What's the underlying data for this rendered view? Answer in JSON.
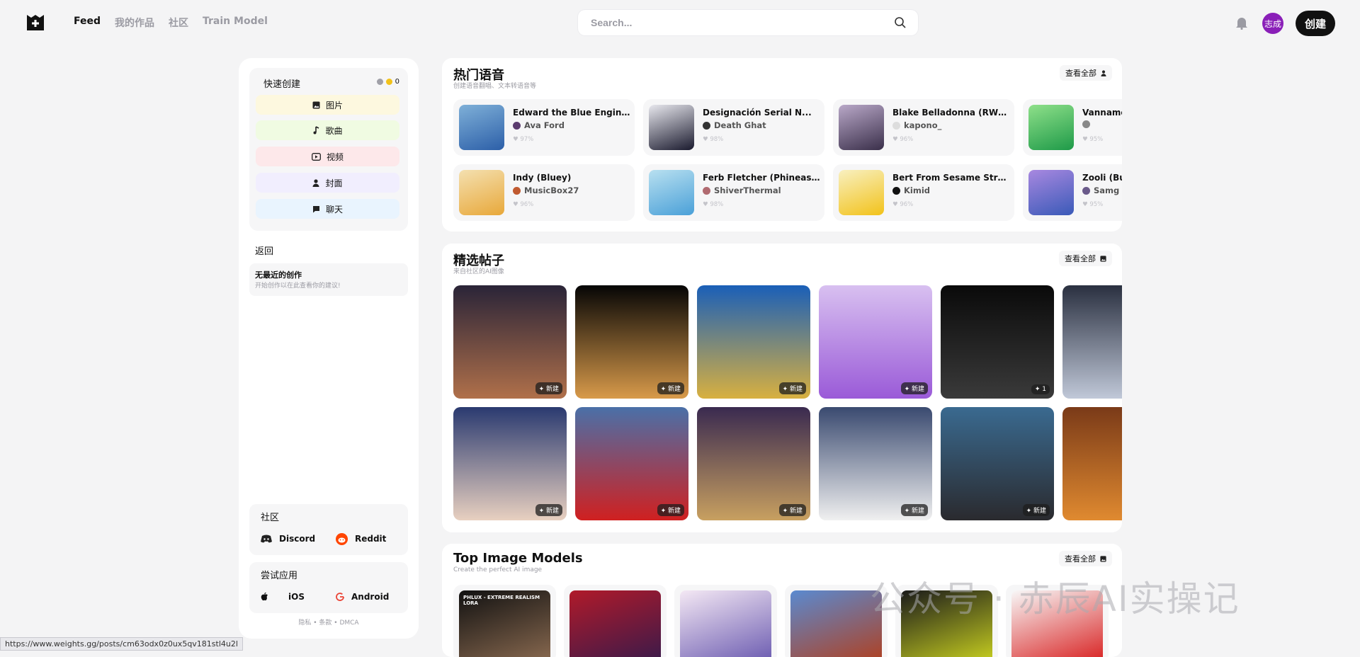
{
  "nav": {
    "feed": "Feed",
    "my_works": "我的作品",
    "community": "社区",
    "train": "Train Model"
  },
  "search": {
    "placeholder": "Search..."
  },
  "user": {
    "avatar_text": "志成",
    "create_label": "创建"
  },
  "sidebar": {
    "quick_create": "快速创建",
    "coins": "0",
    "buttons": [
      {
        "label": "图片",
        "color": "#fdf8df",
        "icon": "image-icon"
      },
      {
        "label": "歌曲",
        "color": "#f0fbe2",
        "icon": "music-note-icon"
      },
      {
        "label": "视频",
        "color": "#fde8ea",
        "icon": "video-icon"
      },
      {
        "label": "封面",
        "color": "#f1eefe",
        "icon": "person-icon"
      },
      {
        "label": "聊天",
        "color": "#e9f4fe",
        "icon": "chat-icon"
      }
    ],
    "back": "返回",
    "recent_title": "无最近的创作",
    "recent_sub": "开始创作以在此查看你的建议!",
    "community": "社区",
    "discord": "Discord",
    "reddit": "Reddit",
    "try_app": "尝试应用",
    "ios": "iOS",
    "android": "Android",
    "footer": "隐私 • 条款 • DMCA"
  },
  "voices": {
    "title": "热门语音",
    "subtitle": "创建语音翻唱、文本转语音等",
    "view_all": "查看全部",
    "items": [
      {
        "name": "Edward the Blue Engine...",
        "author": "Ava Ford",
        "pct": "97%",
        "c1": "#2c5fa8",
        "c2": "#7fb0d8",
        "ac": "#5b3b6e"
      },
      {
        "name": "Designación Serial N...",
        "author": "Death Ghat",
        "pct": "98%",
        "c1": "#1a1a2e",
        "c2": "#e8e8ee",
        "ac": "#333"
      },
      {
        "name": "Blake Belladonna (RWBY)",
        "author": "kapono_",
        "pct": "96%",
        "c1": "#3a2f4a",
        "c2": "#b9a8c8",
        "ac": "#ddd"
      },
      {
        "name": "Vannamelon",
        "author": "",
        "pct": "95%",
        "c1": "#1e9a48",
        "c2": "#8fe08a",
        "ac": "#888"
      },
      {
        "name": "Indy (Bluey)",
        "author": "MusicBox27",
        "pct": "96%",
        "c1": "#e8a83a",
        "c2": "#f4e0b0",
        "ac": "#c05a30"
      },
      {
        "name": "Ferb Fletcher (Phineas...",
        "author": "ShiverThermal",
        "pct": "98%",
        "c1": "#4aa0d8",
        "c2": "#b8e0f0",
        "ac": "#b06a70"
      },
      {
        "name": "Bert From Sesame Street",
        "author": "Kimid",
        "pct": "96%",
        "c1": "#f2c21a",
        "c2": "#f8f0c0",
        "ac": "#111"
      },
      {
        "name": "Zooli (Bub",
        "author": "Samg",
        "pct": "95%",
        "c1": "#3a5ab8",
        "c2": "#a888e0",
        "ac": "#6a5a8a"
      }
    ]
  },
  "posts": {
    "title": "精选帖子",
    "subtitle": "来自社区的AI图像",
    "view_all": "查看全部",
    "items": [
      {
        "badge": "新建",
        "c1": "#2a2438",
        "c2": "#b0704a"
      },
      {
        "badge": "新建",
        "c1": "#050505",
        "c2": "#d89a4a"
      },
      {
        "badge": "新建",
        "c1": "#1a5fb8",
        "c2": "#d8b040"
      },
      {
        "badge": "新建",
        "c1": "#d8c0f0",
        "c2": "#9a5ad8"
      },
      {
        "badge": "1",
        "c1": "#0a0a0a",
        "c2": "#3a3a3a"
      },
      {
        "badge": "",
        "c1": "#2a3040",
        "c2": "#c0c8d8"
      },
      {
        "badge": "新建",
        "c1": "#2a3a70",
        "c2": "#e8d0c0"
      },
      {
        "badge": "新建",
        "c1": "#4a70a8",
        "c2": "#d02020"
      },
      {
        "badge": "新建",
        "c1": "#3a2a50",
        "c2": "#c8a060"
      },
      {
        "badge": "新建",
        "c1": "#3a4a70",
        "c2": "#f0f0f0"
      },
      {
        "badge": "新建",
        "c1": "#3a6a90",
        "c2": "#2a2a2e"
      },
      {
        "badge": "",
        "c1": "#7a3a18",
        "c2": "#e08a30"
      }
    ]
  },
  "models": {
    "title": "Top Image Models",
    "subtitle": "Create the perfect AI image",
    "view_all": "查看全部",
    "items": [
      {
        "label": "PHLUX - EXTREME REALISM LORA",
        "c1": "#111",
        "c2": "#8a6a50"
      },
      {
        "label": "",
        "c1": "#b01a2a",
        "c2": "#3a1a4a"
      },
      {
        "label": "",
        "c1": "#f4e8f4",
        "c2": "#6a5ab0"
      },
      {
        "label": "",
        "c1": "#5a8ad0",
        "c2": "#b04020"
      },
      {
        "label": "",
        "c1": "#1a1a1a",
        "c2": "#c8d020"
      },
      {
        "label": "",
        "c1": "#f8f8f8",
        "c2": "#d82020"
      }
    ]
  },
  "status_url": "https://www.weights.gg/posts/cm63odx0z0ux5qv181stl4u2l",
  "watermark": "公众号 · 赤辰AI实操记"
}
